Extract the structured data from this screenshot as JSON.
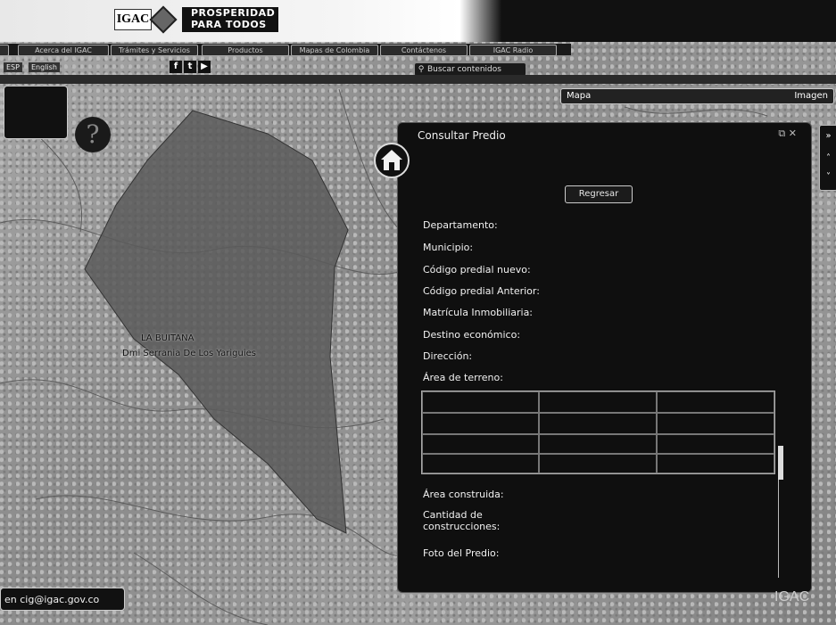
{
  "header": {
    "logo_igac": "IGAC",
    "logo_prosperidad": "PROSPERIDAD PARA TODOS"
  },
  "nav": {
    "items": [
      "Acerca del IGAC",
      "Trámites y Servicios",
      "Productos",
      "Mapas de Colombia",
      "Contáctenos",
      "IGAC Radio"
    ]
  },
  "lang": {
    "es": "ESP",
    "en": "English"
  },
  "search": {
    "placeholder": "Buscar contenidos"
  },
  "map_toggle": {
    "map": "Mapa",
    "image": "Imagen"
  },
  "map_labels": {
    "place": "LA BUITANA",
    "area": "Dmi Serrania De Los Yariguies"
  },
  "panel": {
    "title": "Consultar Predio",
    "back_button": "Regresar",
    "fields": [
      "Departamento:",
      "Municipio:",
      "Código predial nuevo:",
      "Código predial Anterior:",
      "Matrícula Inmobiliaria:",
      "Destino económico:",
      "Dirección:",
      "Área de terreno:"
    ],
    "fields_after": [
      "Área construida:",
      "Cantidad de construcciones:",
      "Foto del Predio:"
    ]
  },
  "contact": "en cig@igac.gov.co",
  "footer_logo": "IGAC",
  "colors": {
    "panel_bg": "#0f0f0f",
    "polygon_fill": "#5a5a5a"
  }
}
